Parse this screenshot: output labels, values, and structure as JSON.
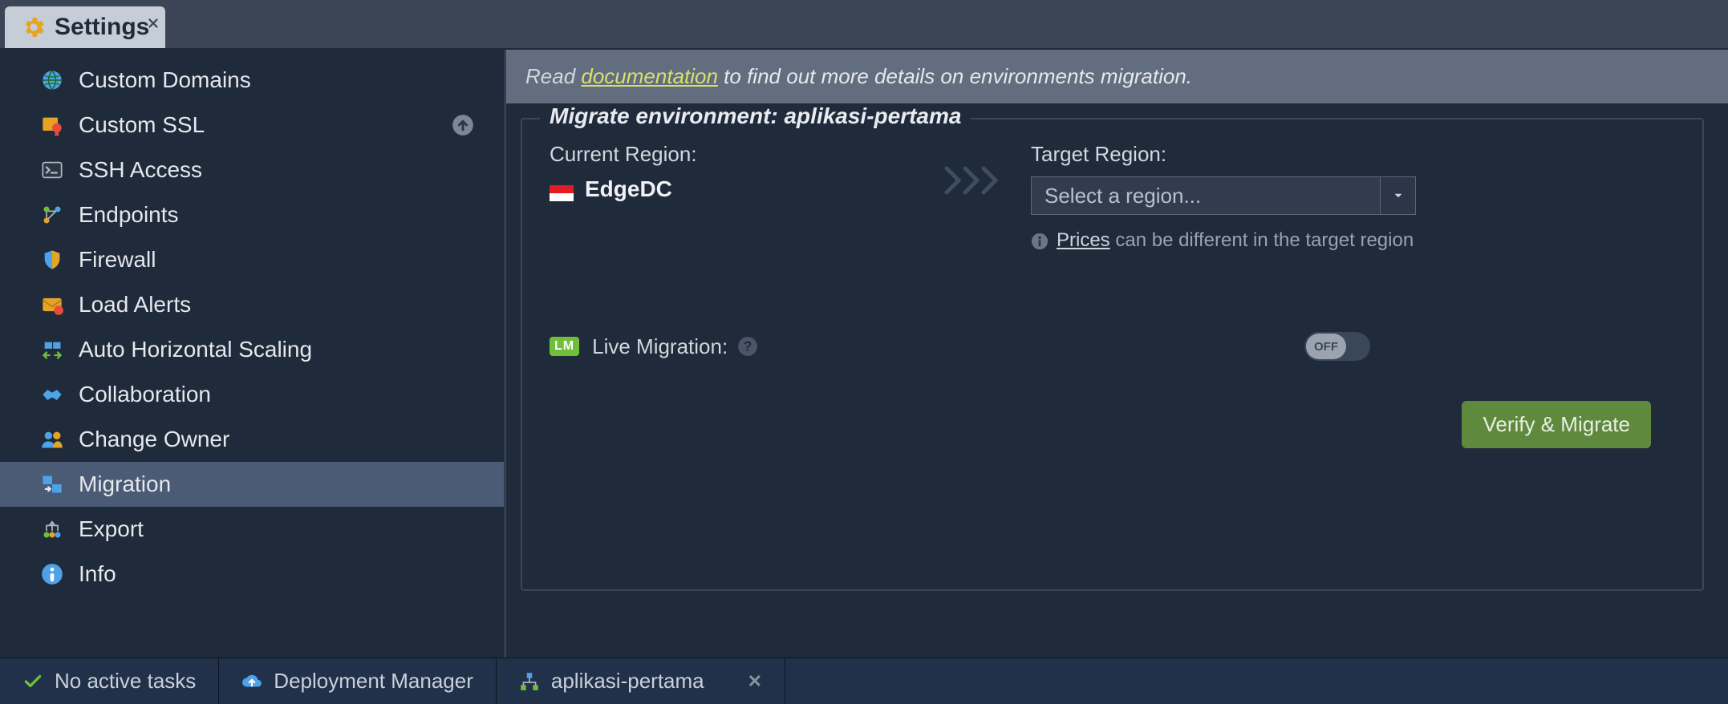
{
  "tab": {
    "title": "Settings"
  },
  "sidebar": {
    "items": [
      {
        "label": "Custom Domains",
        "icon": "globe"
      },
      {
        "label": "Custom SSL",
        "icon": "cert",
        "upload": true
      },
      {
        "label": "SSH Access",
        "icon": "terminal"
      },
      {
        "label": "Endpoints",
        "icon": "endpoints"
      },
      {
        "label": "Firewall",
        "icon": "shield"
      },
      {
        "label": "Load Alerts",
        "icon": "mail"
      },
      {
        "label": "Auto Horizontal Scaling",
        "icon": "scale"
      },
      {
        "label": "Collaboration",
        "icon": "handshake"
      },
      {
        "label": "Change Owner",
        "icon": "users"
      },
      {
        "label": "Migration",
        "icon": "migrate"
      },
      {
        "label": "Export",
        "icon": "export"
      },
      {
        "label": "Info",
        "icon": "info"
      }
    ],
    "active_index": 9
  },
  "banner": {
    "pre": "Read ",
    "link": "documentation",
    "post": " to find out more details on environments migration."
  },
  "panel": {
    "legend": "Migrate environment: aplikasi-pertama",
    "current_label": "Current Region:",
    "current_region": "EdgeDC",
    "target_label": "Target Region:",
    "select_placeholder": "Select a region...",
    "prices_word": "Prices",
    "prices_note_rest": " can be different in the target region",
    "live_badge": "LM",
    "live_label": "Live Migration:",
    "toggle_state": "OFF",
    "verify_btn": "Verify & Migrate"
  },
  "footer": {
    "tasks": "No active tasks",
    "deploy": "Deployment Manager",
    "env": "aplikasi-pertama"
  }
}
